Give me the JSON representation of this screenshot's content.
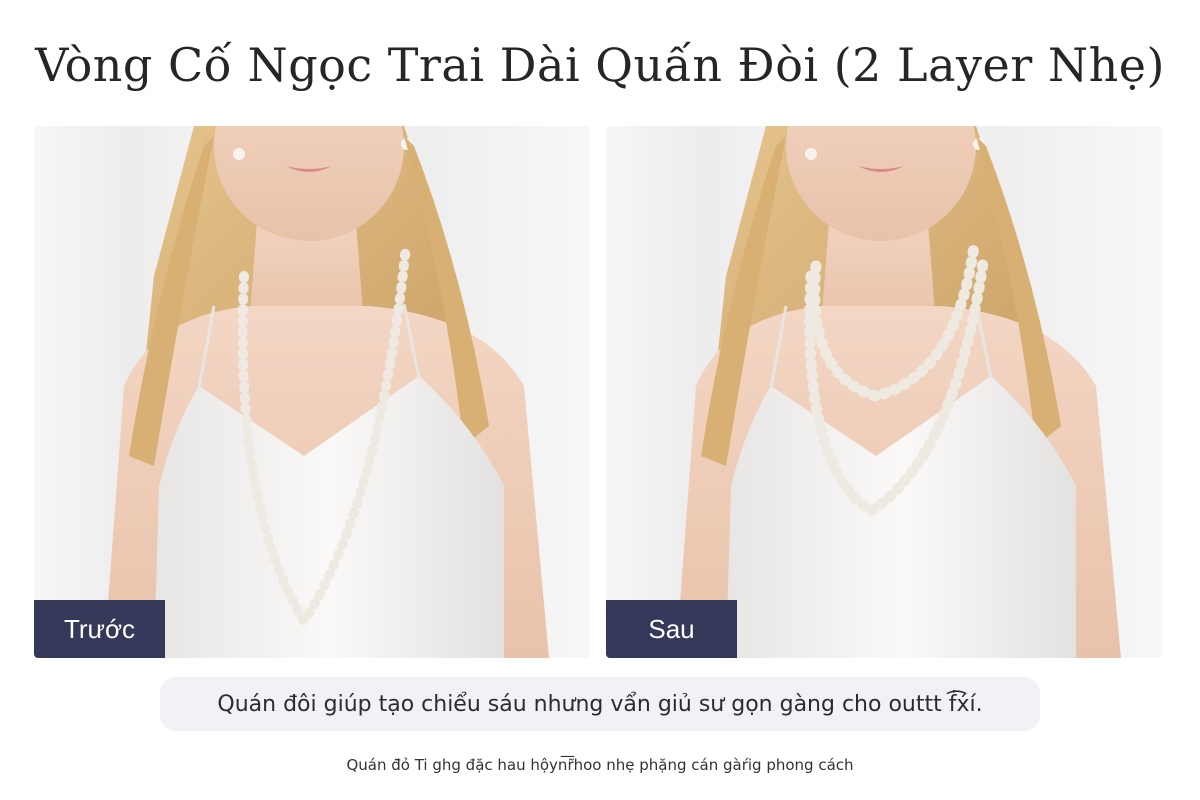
{
  "title": "Vòng Cố Ngọc Trai Dài Quấn Đòi (2 Layer Nhẹ)",
  "panels": [
    {
      "label": "Trước",
      "necklace": "single-long-strand"
    },
    {
      "label": "Sau",
      "necklace": "double-wrapped-strand"
    }
  ],
  "caption": "Quán đôi giúp tạo chiểu sáu nhưng vẩn giủ sư gọn gàng cho outtt ḟ͡x́í.",
  "footnote": "Quán đ̄ỏ Ti ghg đặc hau hộyn͞r̃hoo nhẹ phặng cán gàŕig phong cách",
  "colors": {
    "tag_bg": "#34395a",
    "pill_bg": "#f1f2f7",
    "pearl": "#f4f1ea"
  }
}
